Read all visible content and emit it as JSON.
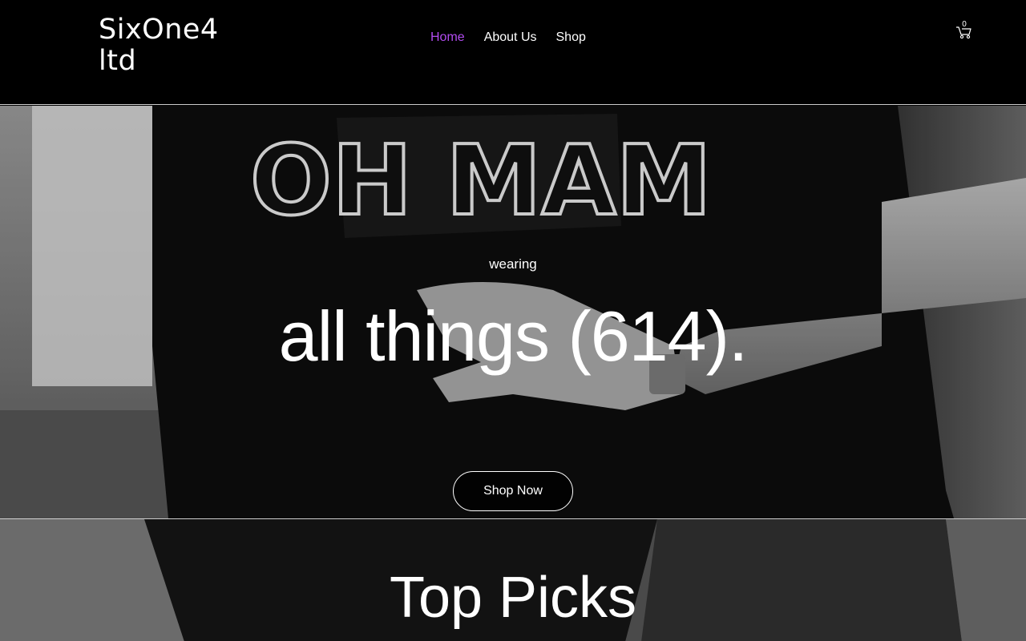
{
  "header": {
    "logo_text": "SixOne4 ltd",
    "nav": [
      {
        "label": "Home",
        "active": true
      },
      {
        "label": "About Us",
        "active": false
      },
      {
        "label": "Shop",
        "active": false
      }
    ],
    "cart_count": "0",
    "cart_icon": "cart-icon"
  },
  "hero": {
    "eyebrow": "wearing",
    "headline": "all things (614).",
    "cta_label": "Shop Now"
  },
  "top_picks": {
    "title": "Top Picks"
  },
  "colors": {
    "accent": "#b24cf0",
    "background": "#000000",
    "text": "#ffffff"
  }
}
